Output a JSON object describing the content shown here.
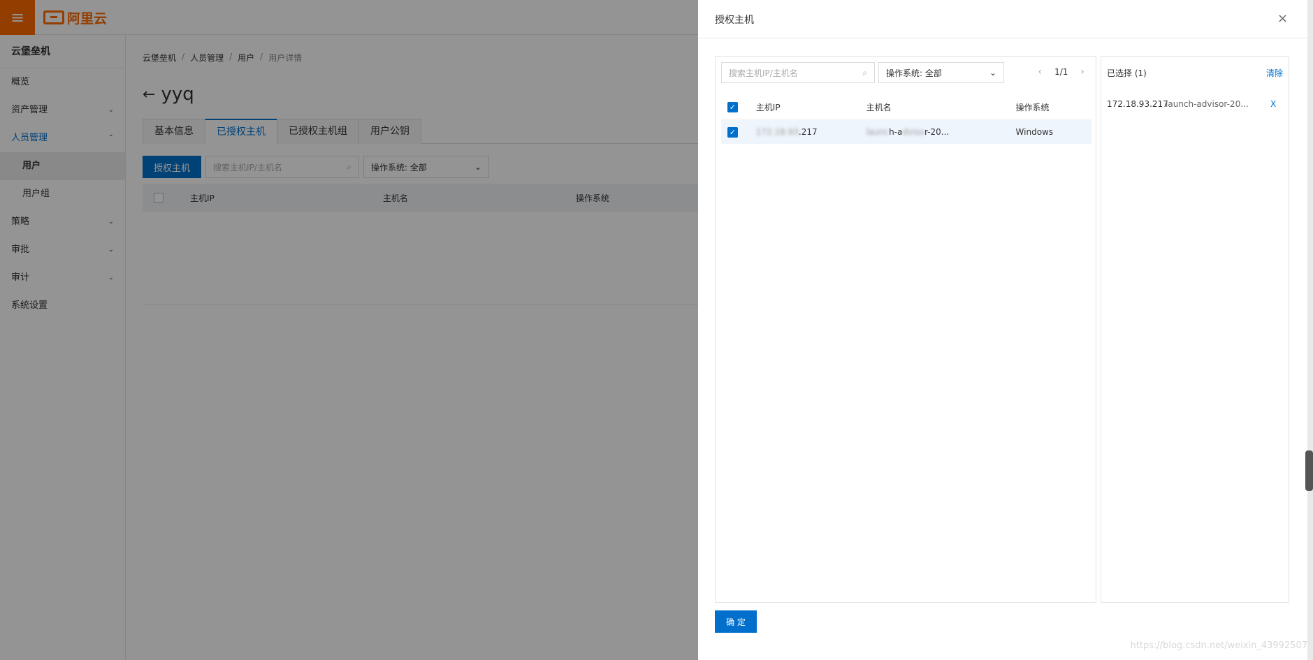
{
  "topbar": {
    "logo_text": "阿里云",
    "menu_icon": "≡"
  },
  "sidebar": {
    "title": "云堡垒机",
    "items": [
      {
        "label": "概览",
        "chevron": ""
      },
      {
        "label": "资产管理",
        "chevron": "⌄"
      },
      {
        "label": "人员管理",
        "chevron": "⌃"
      },
      {
        "label": "用户",
        "chevron": ""
      },
      {
        "label": "用户组",
        "chevron": ""
      },
      {
        "label": "策略",
        "chevron": "⌄"
      },
      {
        "label": "审批",
        "chevron": "⌄"
      },
      {
        "label": "审计",
        "chevron": "⌄"
      },
      {
        "label": "系统设置",
        "chevron": ""
      }
    ]
  },
  "main": {
    "breadcrumb": [
      "云堡垒机",
      "人员管理",
      "用户",
      "用户详情"
    ],
    "breadcrumb_sep": "/",
    "back_arrow": "←",
    "title": "yyq",
    "tabs": [
      "基本信息",
      "已授权主机",
      "已授权主机组",
      "用户公钥"
    ],
    "authorize_button": "授权主机",
    "search_placeholder": "搜索主机IP/主机名",
    "os_select": "操作系统: 全部",
    "table_headers": [
      "主机IP",
      "主机名",
      "操作系统"
    ]
  },
  "drawer": {
    "title": "授权主机",
    "close_icon": "×",
    "search_placeholder": "搜索主机IP/主机名",
    "os_select": "操作系统: 全部",
    "pager": {
      "prev": "‹",
      "text": "1/1",
      "next": "›"
    },
    "table_headers": [
      "主机IP",
      "主机名",
      "操作系统"
    ],
    "rows": [
      {
        "ip_hidden": "172.18.93",
        "ip_visible": ".217",
        "name_a": "launc",
        "name_b": "h-a",
        "name_c": "dviso",
        "name_d": "r-20...",
        "os": "Windows"
      }
    ],
    "selected": {
      "header": "已选择 (1)",
      "clear": "清除",
      "items": [
        {
          "ip": "172.18.93.217",
          "host": "launch-advisor-20...",
          "remove": "X"
        }
      ]
    },
    "confirm_button": "确 定"
  },
  "watermark": "https://blog.csdn.net/weixin_43992507",
  "colors": {
    "brand": "#ff6a00",
    "primary": "#0070cc"
  }
}
